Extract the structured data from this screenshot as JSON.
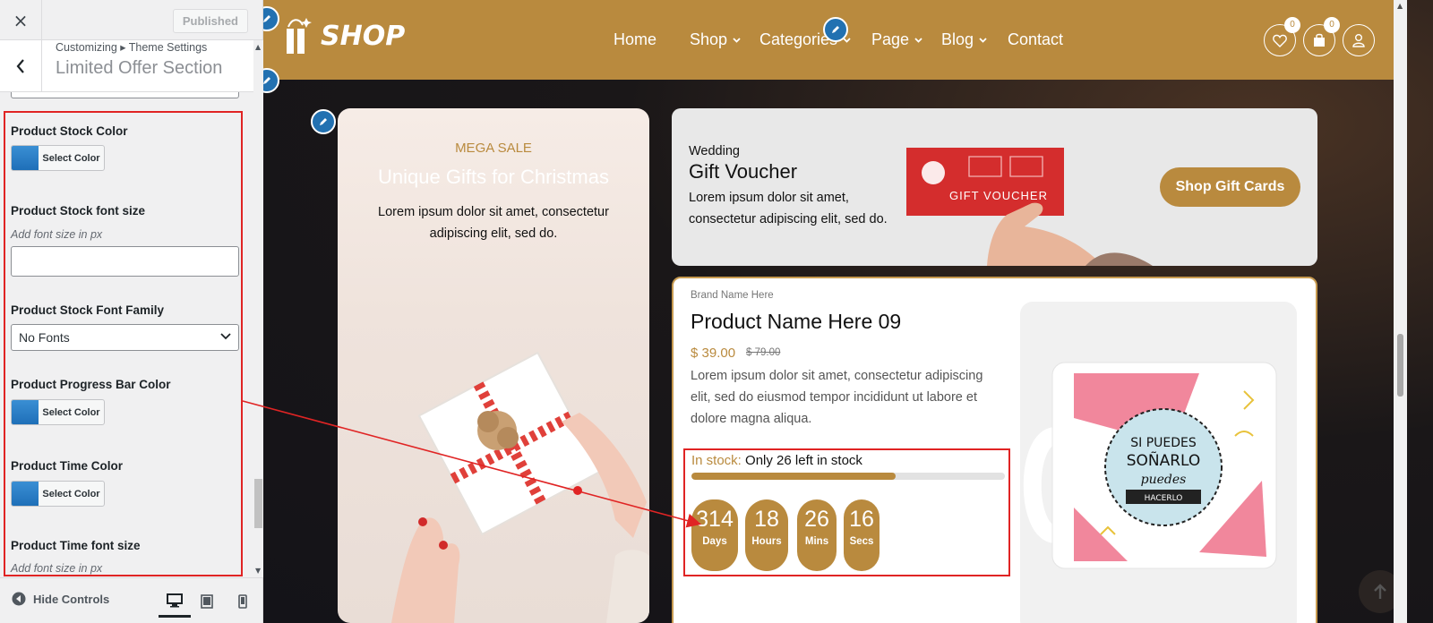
{
  "customizer": {
    "close_icon": "×",
    "published_label": "Published",
    "breadcrumb": "Customizing ▸ Theme Settings",
    "section_title": "Limited Offer Section",
    "controls": {
      "stock_color_label": "Product Stock Color",
      "select_color_label": "Select Color",
      "stock_font_size_label": "Product Stock font size",
      "font_size_hint": "Add font size in px",
      "stock_font_family_label": "Product Stock Font Family",
      "font_family_value": "No Fonts",
      "progress_color_label": "Product Progress Bar Color",
      "time_color_label": "Product Time Color",
      "time_font_size_label": "Product Time font size"
    },
    "footer": {
      "hide_controls_label": "Hide Controls",
      "devices": [
        "desktop",
        "tablet",
        "mobile"
      ],
      "active_device": "desktop"
    }
  },
  "site": {
    "logo_text": "SHOP",
    "nav": [
      {
        "label": "Home",
        "has_dropdown": false
      },
      {
        "label": "Shop",
        "has_dropdown": true
      },
      {
        "label": "Categories",
        "has_dropdown": true
      },
      {
        "label": "Page",
        "has_dropdown": true
      },
      {
        "label": "Blog",
        "has_dropdown": true
      },
      {
        "label": "Contact",
        "has_dropdown": false
      }
    ],
    "wishlist_count": "0",
    "cart_count": "0",
    "brand_color": "#b98a3e",
    "promo": {
      "eyebrow": "MEGA SALE",
      "title": "Unique Gifts for Christmas",
      "description": "Lorem ipsum dolor sit amet, consectetur adipiscing elit, sed do."
    },
    "voucher": {
      "eyebrow": "Wedding",
      "title": "Gift Voucher",
      "description": "Lorem ipsum dolor sit amet, consectetur adipiscing elit, sed do.",
      "card_text": "GIFT VOUCHER",
      "button_label": "Shop Gift Cards"
    },
    "product": {
      "brand": "Brand Name Here",
      "name": "Product Name Here 09",
      "price": "$ 39.00",
      "old_price": "$ 79.00",
      "description": "Lorem ipsum dolor sit amet, consectetur adipiscing elit, sed do eiusmod tempor incididunt ut labore et dolore magna aliqua.",
      "stock_label": "In stock:",
      "stock_text": "Only 26 left in stock",
      "stock_progress": 0.65,
      "countdown": [
        {
          "value": "314",
          "unit": "Days"
        },
        {
          "value": "18",
          "unit": "Hours"
        },
        {
          "value": "26",
          "unit": "Mins"
        },
        {
          "value": "16",
          "unit": "Secs"
        }
      ],
      "mug_text": [
        "SI PUEDES",
        "SOÑARLO",
        "puedes",
        "HACERLO"
      ]
    }
  }
}
